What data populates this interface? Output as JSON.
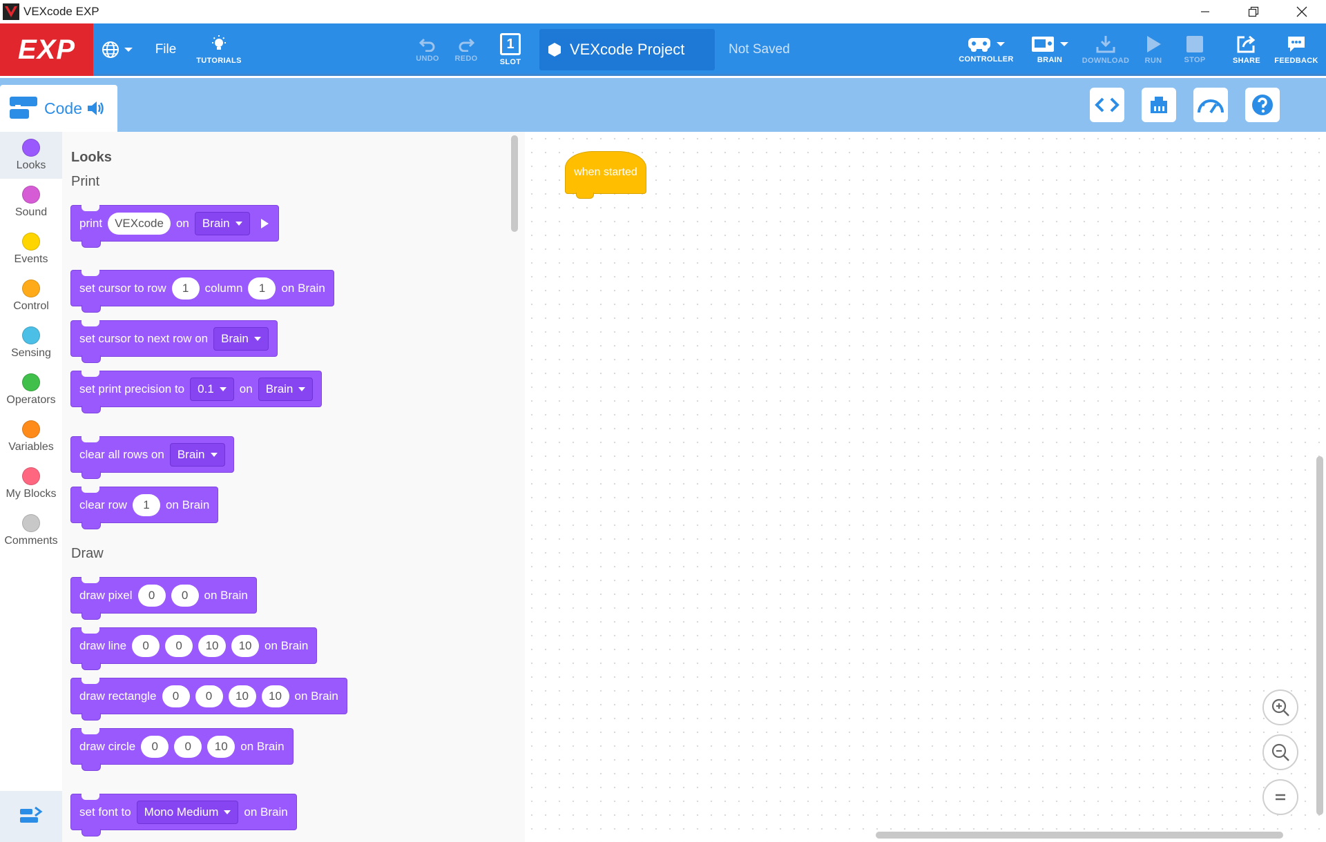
{
  "window": {
    "title": "VEXcode EXP"
  },
  "toolbar": {
    "logo": "EXP",
    "file": "File",
    "tutorials": "TUTORIALS",
    "undo": "UNDO",
    "redo": "REDO",
    "slot_number": "1",
    "slot": "SLOT",
    "project_name": "VEXcode Project",
    "save_status": "Not Saved",
    "controller": "CONTROLLER",
    "brain": "BRAIN",
    "download": "DOWNLOAD",
    "run": "RUN",
    "stop": "STOP",
    "share": "SHARE",
    "feedback": "FEEDBACK"
  },
  "subbar": {
    "code_tab": "Code"
  },
  "categories": [
    {
      "label": "Looks",
      "color": "#9a59fd"
    },
    {
      "label": "Sound",
      "color": "#d65cd6"
    },
    {
      "label": "Events",
      "color": "#ffd500"
    },
    {
      "label": "Control",
      "color": "#ffab19"
    },
    {
      "label": "Sensing",
      "color": "#4cbfe6"
    },
    {
      "label": "Operators",
      "color": "#40bf4a"
    },
    {
      "label": "Variables",
      "color": "#ff8c1a"
    },
    {
      "label": "My Blocks",
      "color": "#ff6680"
    },
    {
      "label": "Comments",
      "color": "#c8c8c8"
    }
  ],
  "palette": {
    "heading": "Looks",
    "print_section": "Print",
    "draw_section": "Draw",
    "print": {
      "t1": "print",
      "v1": "VEXcode",
      "t2": "on",
      "dd1": "Brain"
    },
    "set_cursor": {
      "t1": "set cursor to row",
      "v1": "1",
      "t2": "column",
      "v2": "1",
      "t3": "on Brain"
    },
    "next_row": {
      "t1": "set cursor to next row on",
      "dd1": "Brain"
    },
    "precision": {
      "t1": "set print precision to",
      "dd1": "0.1",
      "t2": "on",
      "dd2": "Brain"
    },
    "clear_all": {
      "t1": "clear all rows on",
      "dd1": "Brain"
    },
    "clear_row": {
      "t1": "clear row",
      "v1": "1",
      "t2": "on Brain"
    },
    "draw_pixel": {
      "t1": "draw pixel",
      "v1": "0",
      "v2": "0",
      "t2": "on Brain"
    },
    "draw_line": {
      "t1": "draw line",
      "v1": "0",
      "v2": "0",
      "v3": "10",
      "v4": "10",
      "t2": "on Brain"
    },
    "draw_rect": {
      "t1": "draw rectangle",
      "v1": "0",
      "v2": "0",
      "v3": "10",
      "v4": "10",
      "t2": "on Brain"
    },
    "draw_circle": {
      "t1": "draw circle",
      "v1": "0",
      "v2": "0",
      "v3": "10",
      "t2": "on Brain"
    },
    "set_font": {
      "t1": "set font to",
      "dd1": "Mono Medium",
      "t2": "on Brain"
    }
  },
  "workspace": {
    "hat_block": "when started"
  }
}
